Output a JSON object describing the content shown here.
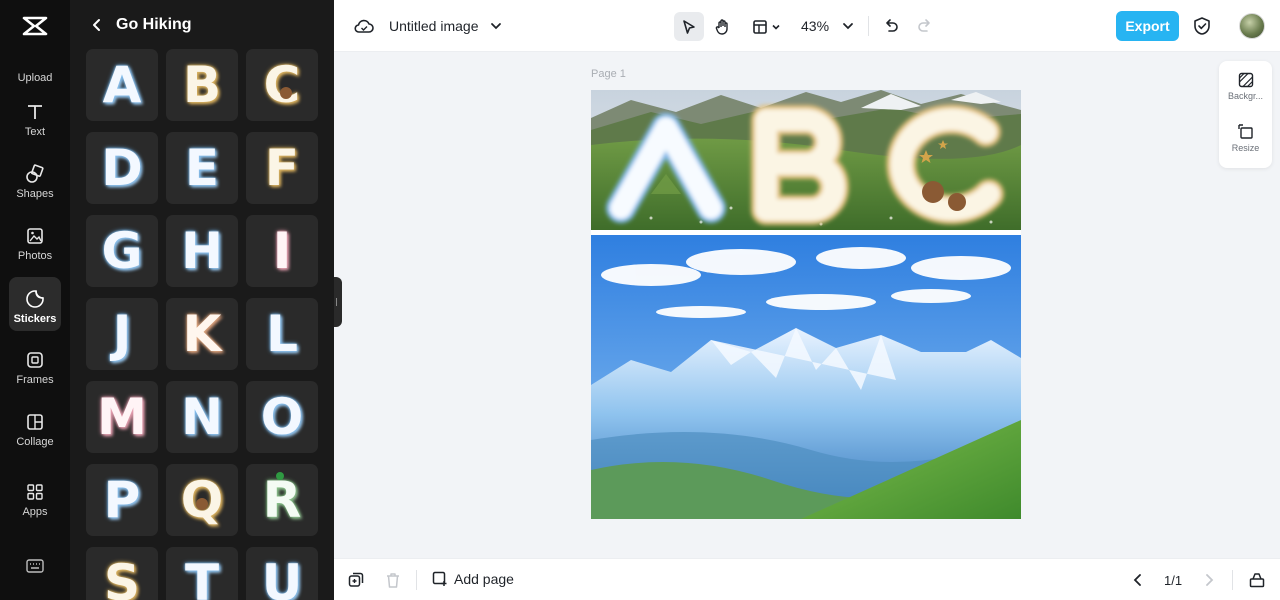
{
  "rail": {
    "items": [
      {
        "label": "Upload",
        "icon": "upload-icon"
      },
      {
        "label": "Text",
        "icon": "text-icon"
      },
      {
        "label": "Shapes",
        "icon": "shapes-icon"
      },
      {
        "label": "Photos",
        "icon": "photos-icon"
      },
      {
        "label": "Stickers",
        "icon": "stickers-icon",
        "active": true
      },
      {
        "label": "Frames",
        "icon": "frames-icon"
      },
      {
        "label": "Collage",
        "icon": "collage-icon"
      },
      {
        "label": "Apps",
        "icon": "apps-icon"
      }
    ]
  },
  "panel": {
    "title": "Go Hiking",
    "stickers": [
      "A",
      "B",
      "C",
      "D",
      "E",
      "F",
      "G",
      "H",
      "I",
      "J",
      "K",
      "L",
      "M",
      "N",
      "O",
      "P",
      "Q",
      "R",
      "S",
      "T",
      "U"
    ]
  },
  "topbar": {
    "doc_title": "Untitled image",
    "zoom": "43%",
    "export_label": "Export"
  },
  "canvas": {
    "page_label": "Page 1",
    "banner_letters": [
      "A",
      "B",
      "C"
    ]
  },
  "side_tools": {
    "background_label": "Backgr...",
    "resize_label": "Resize"
  },
  "bottombar": {
    "add_page_label": "Add page",
    "page_count": "1/1"
  },
  "colors": {
    "accent": "#27b4f2",
    "rail_bg": "#0f0f0f",
    "panel_bg": "#1a1a1a"
  }
}
